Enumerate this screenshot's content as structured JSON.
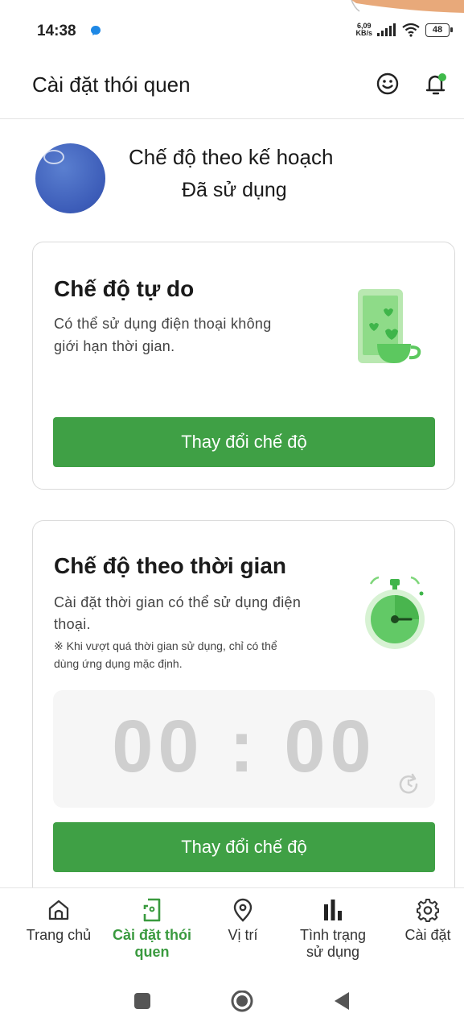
{
  "status_bar": {
    "time": "14:38",
    "net_speed_value": "6,09",
    "net_speed_unit": "KB/s",
    "battery": "48"
  },
  "header": {
    "title": "Cài đặt thói quen",
    "icons": [
      "smile-icon",
      "bell-icon"
    ]
  },
  "current_mode": {
    "title": "Chế độ theo kế hoạch",
    "status": "Đã sử dụng"
  },
  "free_mode": {
    "title": "Chế độ tự do",
    "description_line1": "Có thể sử dụng điện thoại không",
    "description_line2": "giới hạn thời gian.",
    "button_label": "Thay đổi chế độ"
  },
  "timed_mode": {
    "title": "Chế độ theo thời gian",
    "description_line1": "Cài đặt thời gian có thể sử dụng điện",
    "description_line2": "thoại.",
    "note_line1": "※ Khi vượt quá thời gian sử dụng, chỉ có thể",
    "note_line2": "dùng ứng dụng mặc định.",
    "timer_hours": "00",
    "timer_sep": ":",
    "timer_minutes": "00",
    "button_label": "Thay đổi chế độ"
  },
  "bottom_nav": {
    "items": [
      {
        "label_line1": "Trang chủ",
        "label_line2": "",
        "icon": "home-icon",
        "active": false
      },
      {
        "label_line1": "Cài đặt thói",
        "label_line2": "quen",
        "icon": "phone-settings-icon",
        "active": true
      },
      {
        "label_line1": "Vị trí",
        "label_line2": "",
        "icon": "location-pin-icon",
        "active": false
      },
      {
        "label_line1": "Tình trạng",
        "label_line2": "sử dụng",
        "icon": "bar-chart-icon",
        "active": false
      },
      {
        "label_line1": "Cài đặt",
        "label_line2": "",
        "icon": "gear-icon",
        "active": false
      }
    ]
  },
  "colors": {
    "accent_green": "#3fa045",
    "active_nav": "#3a9a3f",
    "timer_text": "#cfcfcf"
  }
}
